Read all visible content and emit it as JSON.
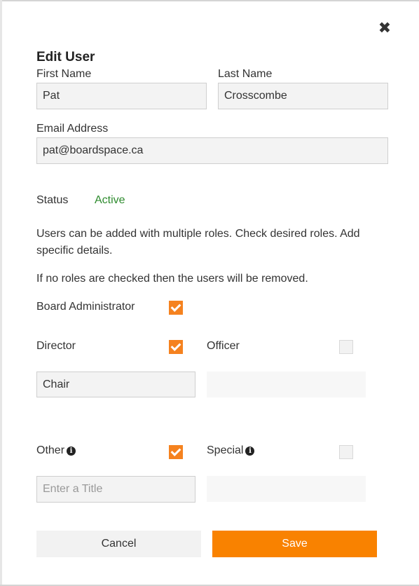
{
  "dialog": {
    "title": "Edit User",
    "close_icon": "close-icon"
  },
  "fields": {
    "first_name": {
      "label": "First Name",
      "value": "Pat"
    },
    "last_name": {
      "label": "Last Name",
      "value": "Crosscombe"
    },
    "email": {
      "label": "Email Address",
      "value": "pat@boardspace.ca"
    }
  },
  "status": {
    "label": "Status",
    "value": "Active",
    "value_color": "#2e8b2e"
  },
  "help": {
    "roles_text": "Users can be added with multiple roles. Check desired roles. Add specific details.",
    "remove_text": "If no roles are checked then the users will be removed."
  },
  "roles": {
    "board_admin": {
      "label": "Board Administrator",
      "checked": true
    },
    "director": {
      "label": "Director",
      "checked": true,
      "title_value": "Chair"
    },
    "officer": {
      "label": "Officer",
      "checked": false,
      "title_value": ""
    },
    "other": {
      "label": "Other",
      "checked": true,
      "title_value": "",
      "title_placeholder": "Enter a Title"
    },
    "special": {
      "label": "Special",
      "checked": false,
      "title_value": ""
    }
  },
  "buttons": {
    "cancel": "Cancel",
    "save": "Save"
  },
  "colors": {
    "accent": "#f98200",
    "checkbox_on": "#f5821f"
  }
}
